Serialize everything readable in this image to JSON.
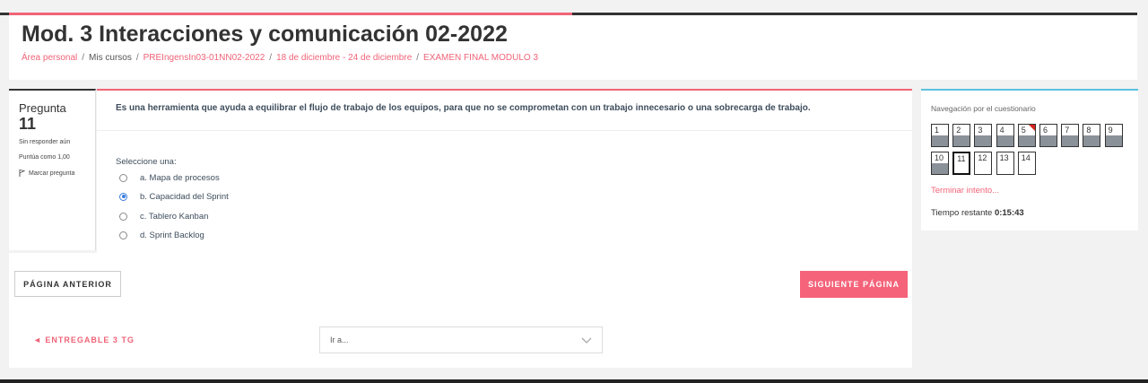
{
  "course_title": "Mod. 3 Interacciones y comunicación 02-2022",
  "breadcrumb": {
    "home": "Área personal",
    "courses": "Mis cursos",
    "course": "PREIngensIn03-01NN02-2022",
    "section": "18 de diciembre - 24 de diciembre",
    "quiz": "EXAMEN FINAL MODULO 3"
  },
  "question_info": {
    "label": "Pregunta",
    "number": "11",
    "status": "Sin responder aún",
    "grade": "Puntúa como 1,00",
    "flag_label": "Marcar pregunta"
  },
  "question": {
    "text": "Es una herramienta que ayuda a equilibrar el flujo de trabajo de los equipos, para que no se comprometan con un trabajo innecesario o una sobrecarga de trabajo.",
    "prompt": "Seleccione una:",
    "selected_index": 1,
    "answers": [
      "a. Mapa de procesos",
      "b. Capacidad del Sprint",
      "c. Tablero Kanban",
      "d. Sprint Backlog"
    ]
  },
  "buttons": {
    "prev_page": "PÁGINA ANTERIOR",
    "next_page": "SIGUIENTE PÁGINA"
  },
  "activity_nav": {
    "prev_activity": "◄ ENTREGABLE 3 TG",
    "jump_placeholder": "Ir a..."
  },
  "quiz_nav": {
    "title": "Navegación por el cuestionario",
    "questions": [
      {
        "n": "1",
        "answered": true
      },
      {
        "n": "2",
        "answered": true
      },
      {
        "n": "3",
        "answered": true
      },
      {
        "n": "4",
        "answered": true
      },
      {
        "n": "5",
        "answered": true,
        "flagged": true
      },
      {
        "n": "6",
        "answered": true
      },
      {
        "n": "7",
        "answered": true
      },
      {
        "n": "8",
        "answered": true
      },
      {
        "n": "9",
        "answered": true
      },
      {
        "n": "10",
        "answered": true
      },
      {
        "n": "11",
        "answered": false,
        "current": true
      },
      {
        "n": "12",
        "answered": false
      },
      {
        "n": "13",
        "answered": false
      },
      {
        "n": "14",
        "answered": false
      }
    ],
    "finish_link": "Terminar intento...",
    "time_label": "Tiempo restante",
    "time_value": "0:15:43"
  },
  "colors": {
    "accent": "#f06478",
    "next_button": "#f4637a",
    "answered_fill": "#8b9199",
    "flag": "#d9231c",
    "nav_border": "#5bc0de"
  }
}
